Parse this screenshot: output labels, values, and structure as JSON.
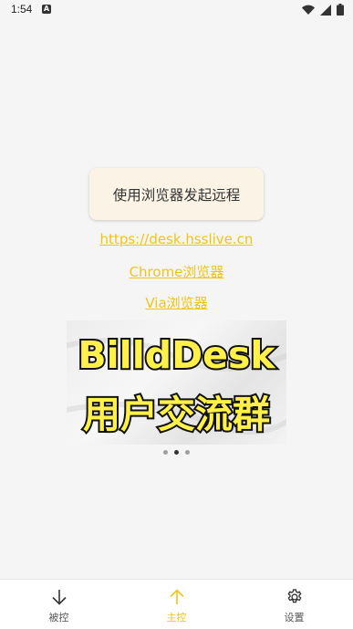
{
  "status_bar": {
    "time": "1:54",
    "notification_badge": "A"
  },
  "main": {
    "launch_button_label": "使用浏览器发起远程",
    "links": [
      "https://desk.hsslive.cn",
      "Chrome浏览器",
      "Via浏览器"
    ],
    "banner": {
      "line1": "BilldDesk",
      "line2": "用户交流群"
    },
    "carousel": {
      "total": 3,
      "active_index": 1
    }
  },
  "bottom_nav": {
    "items": [
      {
        "label": "被控",
        "icon": "arrow-down-icon"
      },
      {
        "label": "主控",
        "icon": "arrow-up-icon"
      },
      {
        "label": "设置",
        "icon": "gear-icon"
      }
    ],
    "active_index": 1
  },
  "colors": {
    "accent": "#f0c419",
    "button_bg": "#fbf4e6",
    "page_bg": "#f5f5f5"
  }
}
